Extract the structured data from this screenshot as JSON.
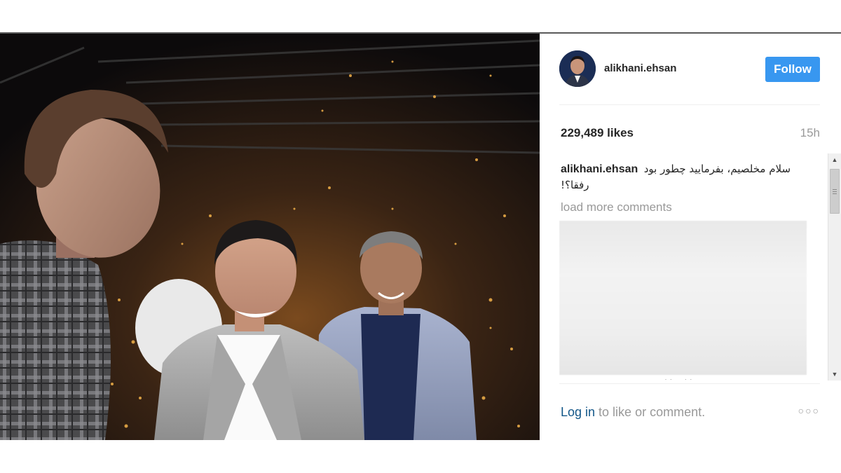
{
  "post": {
    "username": "alikhani.ehsan",
    "follow_label": "Follow",
    "likes": "229,489 likes",
    "time_ago": "15h",
    "caption_user": "alikhani.ehsan",
    "caption_text": "سلام مخلصیم، بفرمایید چطور بود رفقا؟!",
    "load_more": "load more comments",
    "login_link": "Log in",
    "login_rest": " to like or comment.",
    "more_icon": "more-options-icon"
  },
  "colors": {
    "follow_button": "#3897f0",
    "link": "#125688",
    "muted": "#999999"
  }
}
